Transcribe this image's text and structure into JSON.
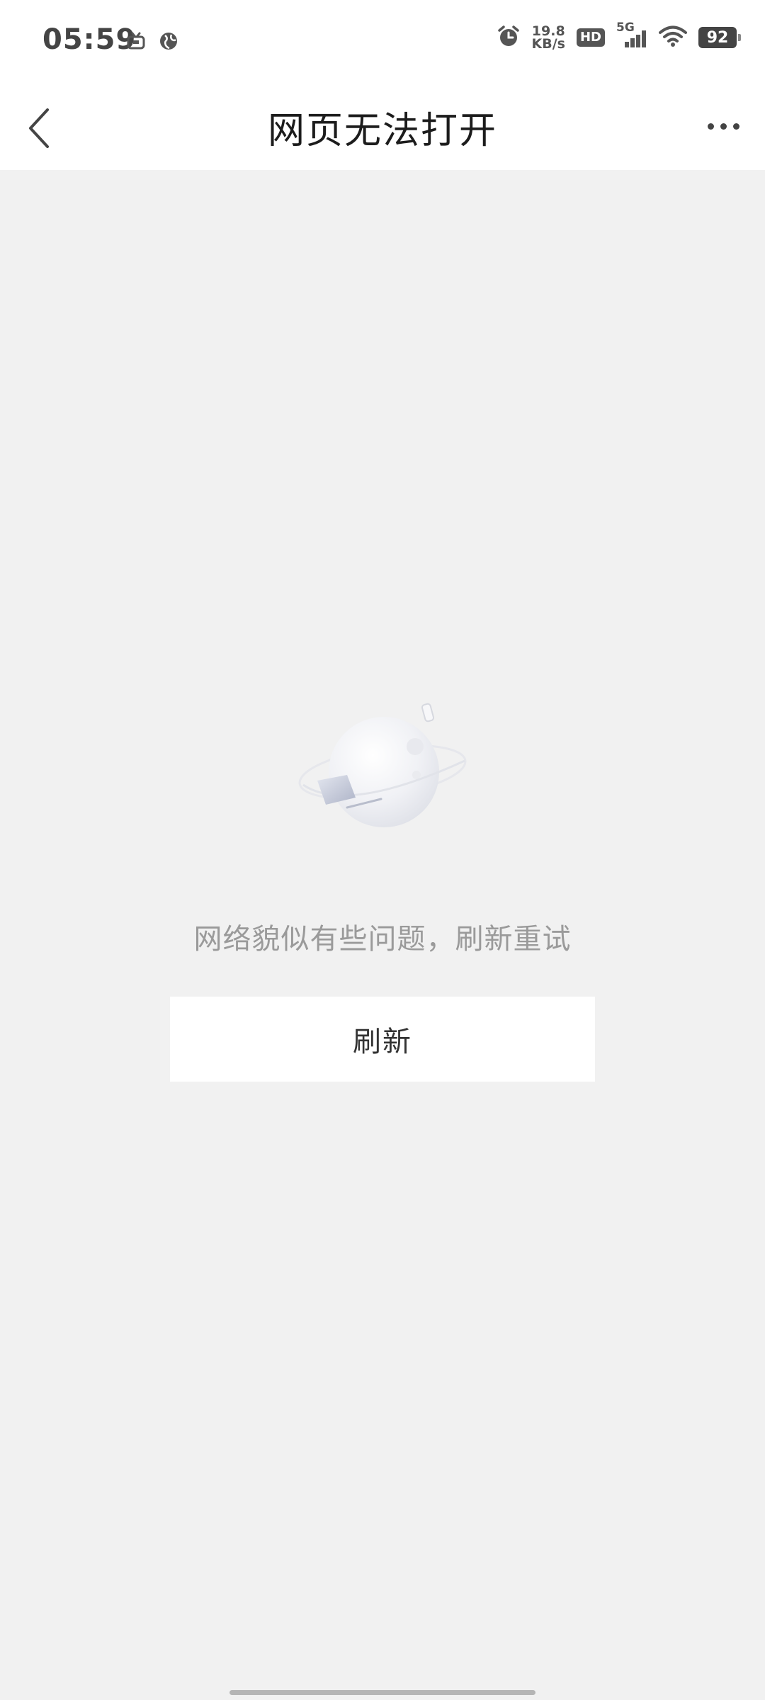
{
  "status_bar": {
    "time": "05:59",
    "net_speed_value": "19.8",
    "net_speed_unit": "KB/s",
    "hd_label": "HD",
    "network_type": "5G",
    "battery_level": "92"
  },
  "nav": {
    "title": "网页无法打开"
  },
  "content": {
    "error_message": "网络貌似有些问题，刷新重试",
    "refresh_label": "刷新"
  },
  "icons": {
    "back": "chevron-left-icon",
    "more": "more-dots-icon",
    "illustration": "planet-illustration"
  }
}
